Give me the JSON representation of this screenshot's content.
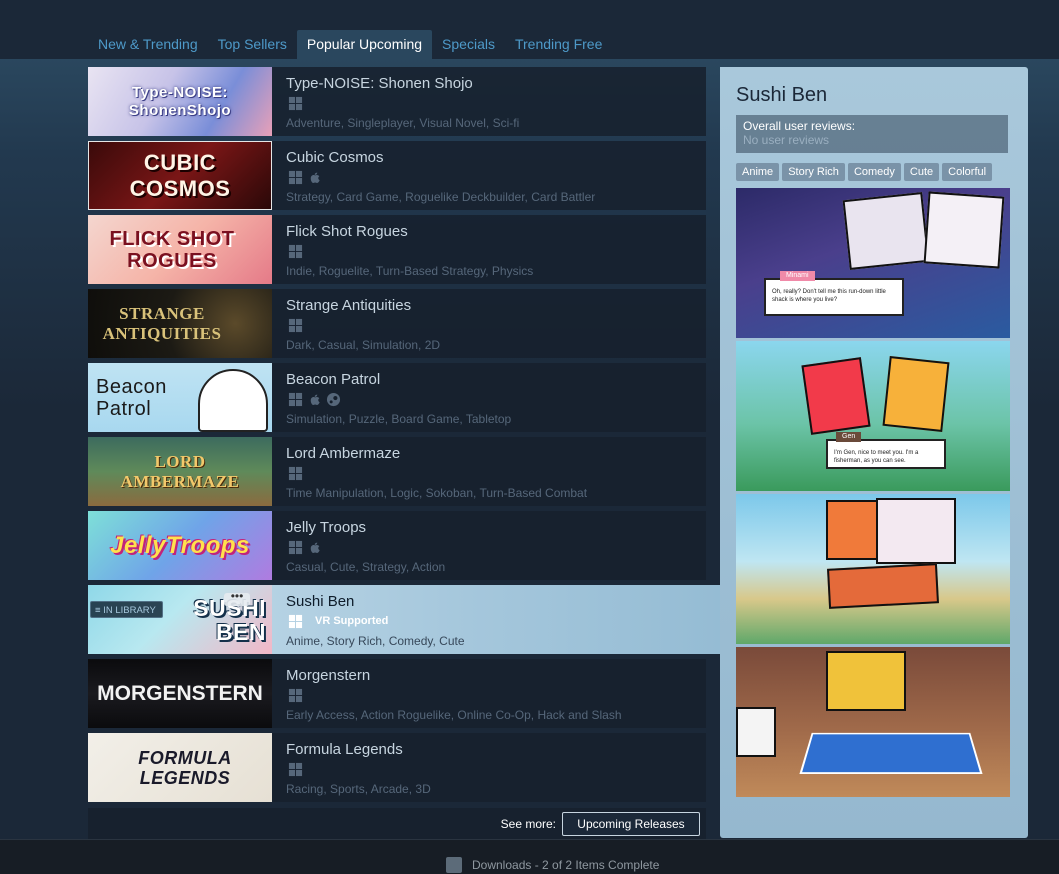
{
  "tabs": [
    {
      "label": "New & Trending",
      "active": false
    },
    {
      "label": "Top Sellers",
      "active": false
    },
    {
      "label": "Popular Upcoming",
      "active": true
    },
    {
      "label": "Specials",
      "active": false
    },
    {
      "label": "Trending Free",
      "active": false
    }
  ],
  "games": [
    {
      "title": "Type-NOISE: Shonen Shojo",
      "thumb_text": "Type-NOISE: ShonenShojo",
      "tags": "Adventure, Singleplayer, Visual Novel, Sci-fi",
      "platforms": [
        "windows"
      ]
    },
    {
      "title": "Cubic Cosmos",
      "thumb_text": "CUBIC COSMOS",
      "tags": "Strategy, Card Game, Roguelike Deckbuilder, Card Battler",
      "platforms": [
        "windows",
        "mac"
      ]
    },
    {
      "title": "Flick Shot Rogues",
      "thumb_text": "FLICK SHOT ROGUES",
      "tags": "Indie, Roguelite, Turn-Based Strategy, Physics",
      "platforms": [
        "windows"
      ]
    },
    {
      "title": "Strange Antiquities",
      "thumb_text": "STRANGE ANTIQUITIES",
      "tags": "Dark, Casual, Simulation, 2D",
      "platforms": [
        "windows"
      ]
    },
    {
      "title": "Beacon Patrol",
      "thumb_text": "Beacon Patrol",
      "tags": "Simulation, Puzzle, Board Game, Tabletop",
      "platforms": [
        "windows",
        "mac",
        "steam"
      ]
    },
    {
      "title": "Lord Ambermaze",
      "thumb_text": "LORD AMBERMAZE",
      "tags": "Time Manipulation, Logic, Sokoban, Turn-Based Combat",
      "platforms": [
        "windows"
      ]
    },
    {
      "title": "Jelly Troops",
      "thumb_text": "JellyTroops",
      "tags": "Casual, Cute, Strategy, Action",
      "platforms": [
        "windows",
        "mac"
      ]
    },
    {
      "title": "Sushi Ben",
      "thumb_text": "SUSHI BEN",
      "tags": "Anime, Story Rich, Comedy, Cute",
      "platforms": [
        "windows"
      ],
      "vr": "VR Supported",
      "in_library": "IN LIBRARY",
      "hover": true
    },
    {
      "title": "Morgenstern",
      "thumb_text": "MORGENSTERN",
      "tags": "Early Access, Action Roguelike, Online Co-Op, Hack and Slash",
      "platforms": [
        "windows"
      ]
    },
    {
      "title": "Formula Legends",
      "thumb_text": "FORMULA LEGENDS",
      "tags": "Racing, Sports, Arcade, 3D",
      "platforms": [
        "windows"
      ]
    }
  ],
  "see_more": {
    "label": "See more:",
    "button": "Upcoming Releases"
  },
  "detail": {
    "title": "Sushi Ben",
    "reviews_label": "Overall user reviews:",
    "reviews_value": "No user reviews",
    "tags": [
      "Anime",
      "Story Rich",
      "Comedy",
      "Cute",
      "Colorful"
    ],
    "screenshots": [
      {
        "speaker": "Minami",
        "line": "Oh, really? Don't tell me this run-down little shack is where you live?"
      },
      {
        "speaker": "Gen",
        "line": "I'm Gen, nice to meet you. I'm a fisherman, as you can see."
      },
      {
        "speaker": "",
        "line": ""
      },
      {
        "speaker": "",
        "line": ""
      }
    ]
  },
  "footer": {
    "downloads": "Downloads - 2 of 2 Items Complete"
  },
  "colors": {
    "accent": "#4e9ac9",
    "bg": "#1b2838",
    "panel": "#a9c8db"
  }
}
